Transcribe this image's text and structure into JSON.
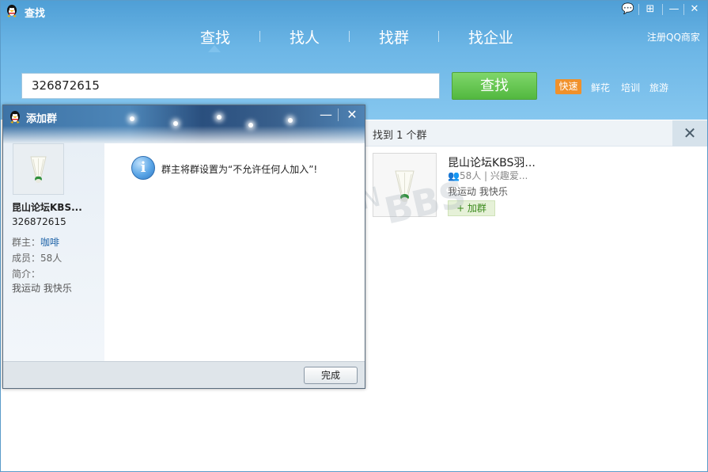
{
  "app": {
    "title": "查找"
  },
  "window_controls": {
    "bubble": "💬",
    "maximize": "⊞",
    "minimize": "—",
    "close": "✕"
  },
  "nav": {
    "tabs": [
      {
        "label": "查找",
        "active": true
      },
      {
        "label": "找人"
      },
      {
        "label": "找群"
      },
      {
        "label": "找企业"
      }
    ],
    "register_link": "注册QQ商家"
  },
  "search": {
    "value": "326872615",
    "button_label": "查找",
    "quick_tag": "快速",
    "hot_tags": [
      "鲜花",
      "培训",
      "旅游"
    ]
  },
  "results": {
    "summary": "找到 1 个群",
    "close": "✕",
    "items": [
      {
        "name": "昆山论坛KBS羽...",
        "members": "58人 | 兴趣爱...",
        "description": "我运动 我快乐",
        "join_label": "+ 加群"
      }
    ]
  },
  "dialog": {
    "title": "添加群",
    "min": "—",
    "close": "✕",
    "group_name": "昆山论坛KBS...",
    "group_id": "326872615",
    "owner_label": "群主：",
    "owner_name": "咖啡",
    "members": "成员：58人",
    "intro_label": "简介：",
    "intro": "我运动 我快乐",
    "message": "群主将群设置为“不允许任何人加入”!",
    "info_icon": "i",
    "done_label": "完成"
  },
  "watermark": {
    "line1": "KUNSHAN",
    "line2": "昆山论坛",
    "line3": "BBS"
  },
  "colors": {
    "top_bg": "#6cb6e6",
    "search_button": "#52b83f",
    "quick_tag": "#f0912b",
    "join_text": "#3b8a1c",
    "owner_link": "#1f63a8"
  }
}
